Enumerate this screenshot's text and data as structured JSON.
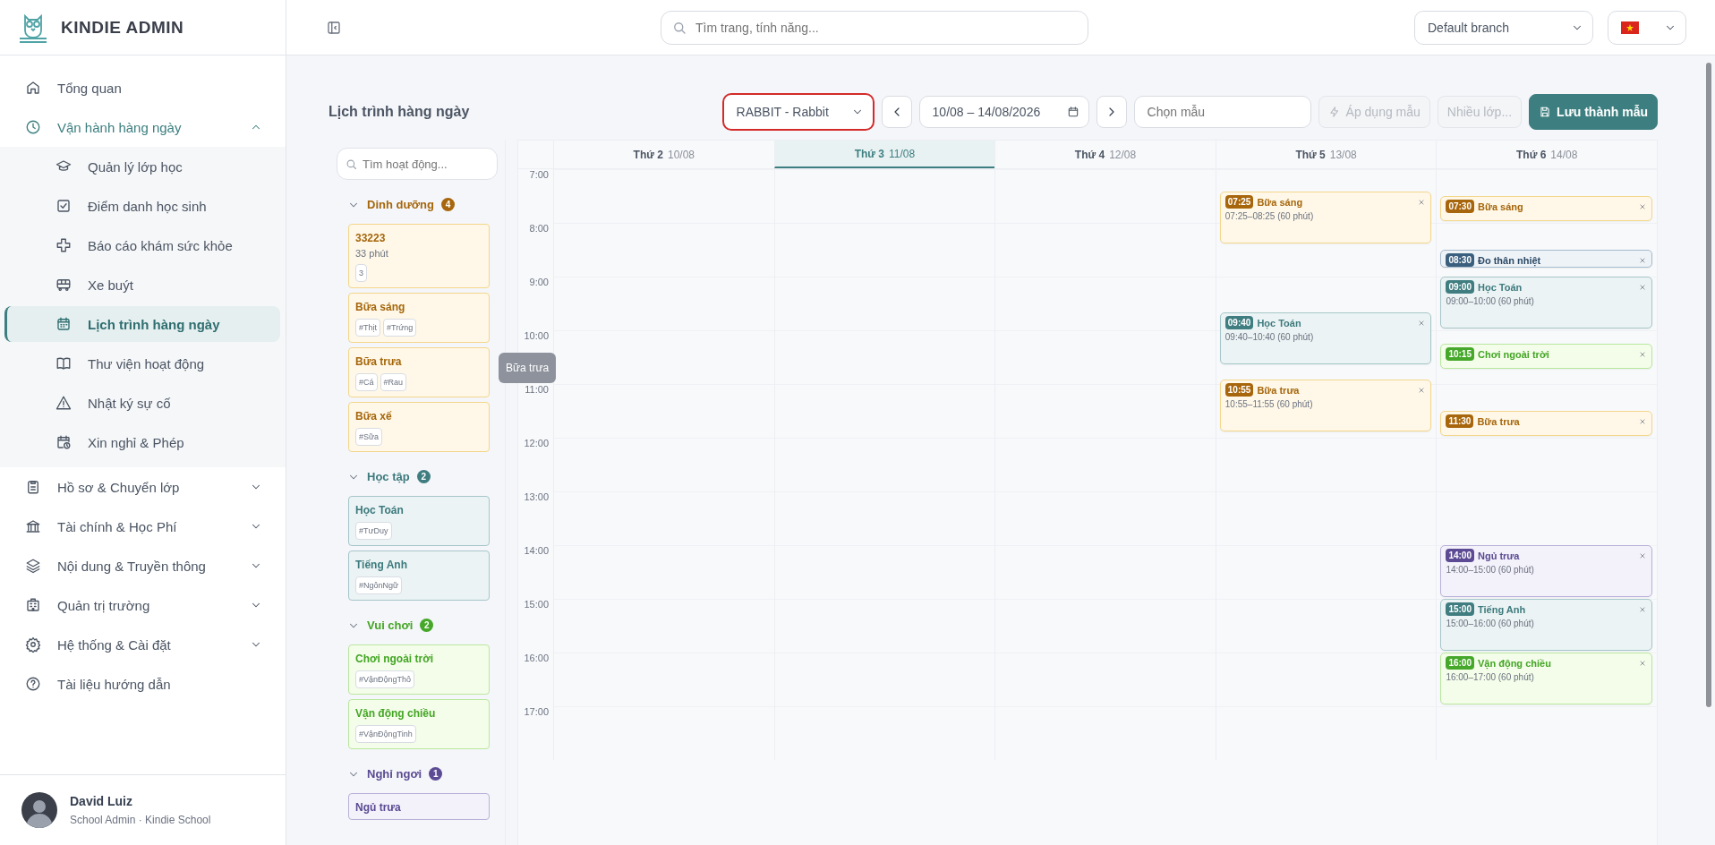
{
  "brand": {
    "name": "KINDIE ADMIN"
  },
  "sidebar": {
    "items": [
      {
        "label": "Tổng quan",
        "kind": "link",
        "selected": false
      },
      {
        "label": "Vận hành hàng ngày",
        "kind": "group",
        "selected": true,
        "expanded": true,
        "children": [
          {
            "label": "Quản lý lớp học",
            "selected": false
          },
          {
            "label": "Điểm danh học sinh",
            "selected": false
          },
          {
            "label": "Báo cáo khám sức khỏe",
            "selected": false
          },
          {
            "label": "Xe buýt",
            "selected": false
          },
          {
            "label": "Lịch trình hàng ngày",
            "selected": true
          },
          {
            "label": "Thư viện hoạt động",
            "selected": false
          },
          {
            "label": "Nhật ký sự cố",
            "selected": false
          },
          {
            "label": "Xin nghỉ & Phép",
            "selected": false
          }
        ]
      },
      {
        "label": "Hồ sơ & Chuyển lớp",
        "kind": "group",
        "selected": false,
        "expanded": false
      },
      {
        "label": "Tài chính & Học Phí",
        "kind": "group",
        "selected": false,
        "expanded": false
      },
      {
        "label": "Nội dung & Truyền thông",
        "kind": "group",
        "selected": false,
        "expanded": false
      },
      {
        "label": "Quản trị trường",
        "kind": "group",
        "selected": false,
        "expanded": false
      },
      {
        "label": "Hệ thống & Cài đặt",
        "kind": "group",
        "selected": false,
        "expanded": false
      },
      {
        "label": "Tài liệu hướng dẫn",
        "kind": "link",
        "selected": false
      }
    ]
  },
  "user": {
    "name": "David Luiz",
    "role": "School Admin · Kindie School"
  },
  "header": {
    "search": {
      "placeholder": "Tìm trang, tính năng..."
    },
    "branch": {
      "value": "Default branch"
    }
  },
  "toolbar": {
    "title": "Lịch trình hàng ngày",
    "class_select": {
      "value": "RABBIT - Rabbit",
      "focused": true
    },
    "date_range": "10/08 – 14/08/2026",
    "template_select": {
      "placeholder": "Chọn mẫu"
    },
    "buttons": [
      {
        "label": "Áp dụng mẫu",
        "kind": "apply",
        "disabled": true
      },
      {
        "label": "Nhiều lớp...",
        "kind": "multi",
        "disabled": true
      },
      {
        "label": "Lưu thành mẫu",
        "kind": "save",
        "disabled": false
      }
    ]
  },
  "palette": {
    "search": {
      "placeholder": "Tìm hoạt động..."
    },
    "groups": [
      {
        "name": "Dinh dưỡng",
        "count": "4",
        "color": "#a8660c",
        "expanded": true,
        "items": [
          {
            "name": "33223",
            "duration": "33 phút",
            "tags": [
              "3"
            ]
          },
          {
            "name": "Bữa sáng",
            "tags": [
              "#Thịt",
              "#Trứng"
            ]
          },
          {
            "name": "Bữa trưa",
            "tags": [
              "#Cá",
              "#Rau"
            ]
          },
          {
            "name": "Bữa xế",
            "tags": [
              "#Sữa"
            ]
          }
        ]
      },
      {
        "name": "Học tập",
        "count": "2",
        "color": "#3f7d80",
        "expanded": true,
        "items": [
          {
            "name": "Học Toán",
            "tags": [
              "#TưDuy"
            ]
          },
          {
            "name": "Tiếng Anh",
            "tags": [
              "#NgônNgữ"
            ]
          }
        ]
      },
      {
        "name": "Vui chơi",
        "count": "2",
        "color": "#46a82a",
        "expanded": true,
        "items": [
          {
            "name": "Chơi ngoài trời",
            "tags": [
              "#VậnĐộngThô"
            ]
          },
          {
            "name": "Vận động chiều",
            "tags": [
              "#VậnĐộngTinh"
            ]
          }
        ]
      },
      {
        "name": "Nghỉ ngơi",
        "count": "1",
        "color": "#5c4b94",
        "expanded": true,
        "items": [
          {
            "name": "Ngủ trưa"
          }
        ]
      }
    ]
  },
  "tooltip": {
    "text": "Bữa trưa"
  },
  "calendar": {
    "hours": [
      "7:00",
      "8:00",
      "9:00",
      "10:00",
      "11:00",
      "12:00",
      "13:00",
      "14:00",
      "15:00",
      "16:00",
      "17:00"
    ],
    "days": [
      {
        "label": "Thứ 2",
        "date": "10/08",
        "selected": false
      },
      {
        "label": "Thứ 3",
        "date": "11/08",
        "selected": true
      },
      {
        "label": "Thứ 4",
        "date": "12/08",
        "selected": false
      },
      {
        "label": "Thứ 5",
        "date": "13/08",
        "selected": false,
        "events": [
          {
            "time": "07:25",
            "title": "Bữa sáng",
            "range": "07:25–08:25 (60 phút)",
            "color": "#a8660c",
            "kind": "full"
          },
          {
            "time": "09:40",
            "title": "Học Toán",
            "range": "09:40–10:40 (60 phút)",
            "color": "#3f7d80",
            "kind": "full"
          },
          {
            "time": "10:55",
            "title": "Bữa trưa",
            "range": "10:55–11:55 (60 phút)",
            "color": "#a8660c",
            "kind": "full"
          }
        ]
      },
      {
        "label": "Thứ 6",
        "date": "14/08",
        "selected": false,
        "events": [
          {
            "time": "07:30",
            "title": "Bữa sáng",
            "color": "#a8660c",
            "kind": "half"
          },
          {
            "time": "08:30",
            "title": "Đo thân nhiệt",
            "color": "#3b5f7e",
            "kind": "small"
          },
          {
            "time": "09:00",
            "title": "Học Toán",
            "range": "09:00–10:00 (60 phút)",
            "color": "#3f7d80",
            "kind": "full"
          },
          {
            "time": "10:15",
            "title": "Chơi ngoài trời",
            "color": "#46a82a",
            "kind": "half"
          },
          {
            "time": "11:30",
            "title": "Bữa trưa",
            "color": "#a8660c",
            "kind": "half"
          },
          {
            "time": "14:00",
            "title": "Ngủ trưa",
            "range": "14:00–15:00 (60 phút)",
            "color": "#5c4b94",
            "kind": "full"
          },
          {
            "time": "15:00",
            "title": "Tiếng Anh",
            "range": "15:00–16:00 (60 phút)",
            "color": "#3f7d80",
            "kind": "full"
          },
          {
            "time": "16:00",
            "title": "Vận động chiều",
            "range": "16:00–17:00 (60 phút)",
            "color": "#46a82a",
            "kind": "full"
          }
        ]
      }
    ]
  }
}
